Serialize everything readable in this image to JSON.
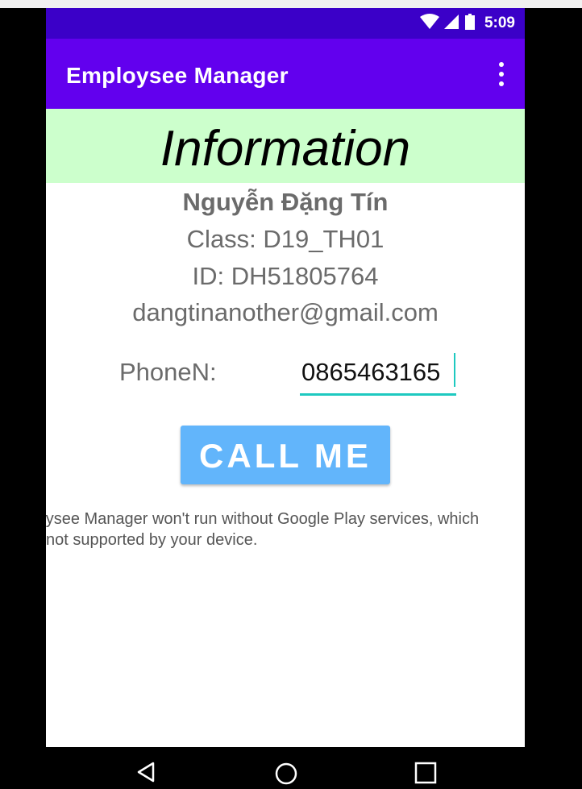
{
  "status_bar": {
    "time": "5:09",
    "icons": [
      "wifi-icon",
      "cell-signal-icon",
      "battery-icon"
    ]
  },
  "app_bar": {
    "title": "Employsee Manager",
    "menu_icon": "overflow-menu-icon"
  },
  "banner": {
    "title": "Information",
    "background": "#ccffcc"
  },
  "profile": {
    "name": "Nguyễn Đặng Tín",
    "class_line": "Class: D19_TH01",
    "id_line": "ID: DH51805764",
    "email": "dangtinanother@gmail.com"
  },
  "phone": {
    "label": "PhoneN:",
    "value": "0865463165"
  },
  "call_button": {
    "label": "CALL ME",
    "color": "#62b5fb"
  },
  "notice": {
    "line1": "ploysee Manager won't run without Google Play services, which",
    "line2": "not supported by your device."
  },
  "nav": {
    "icons": [
      "back-icon",
      "home-icon",
      "recents-icon"
    ]
  },
  "colors": {
    "primary": "#6200ee",
    "primary_dark": "#3b00c8",
    "accent": "#1ec9c0"
  }
}
